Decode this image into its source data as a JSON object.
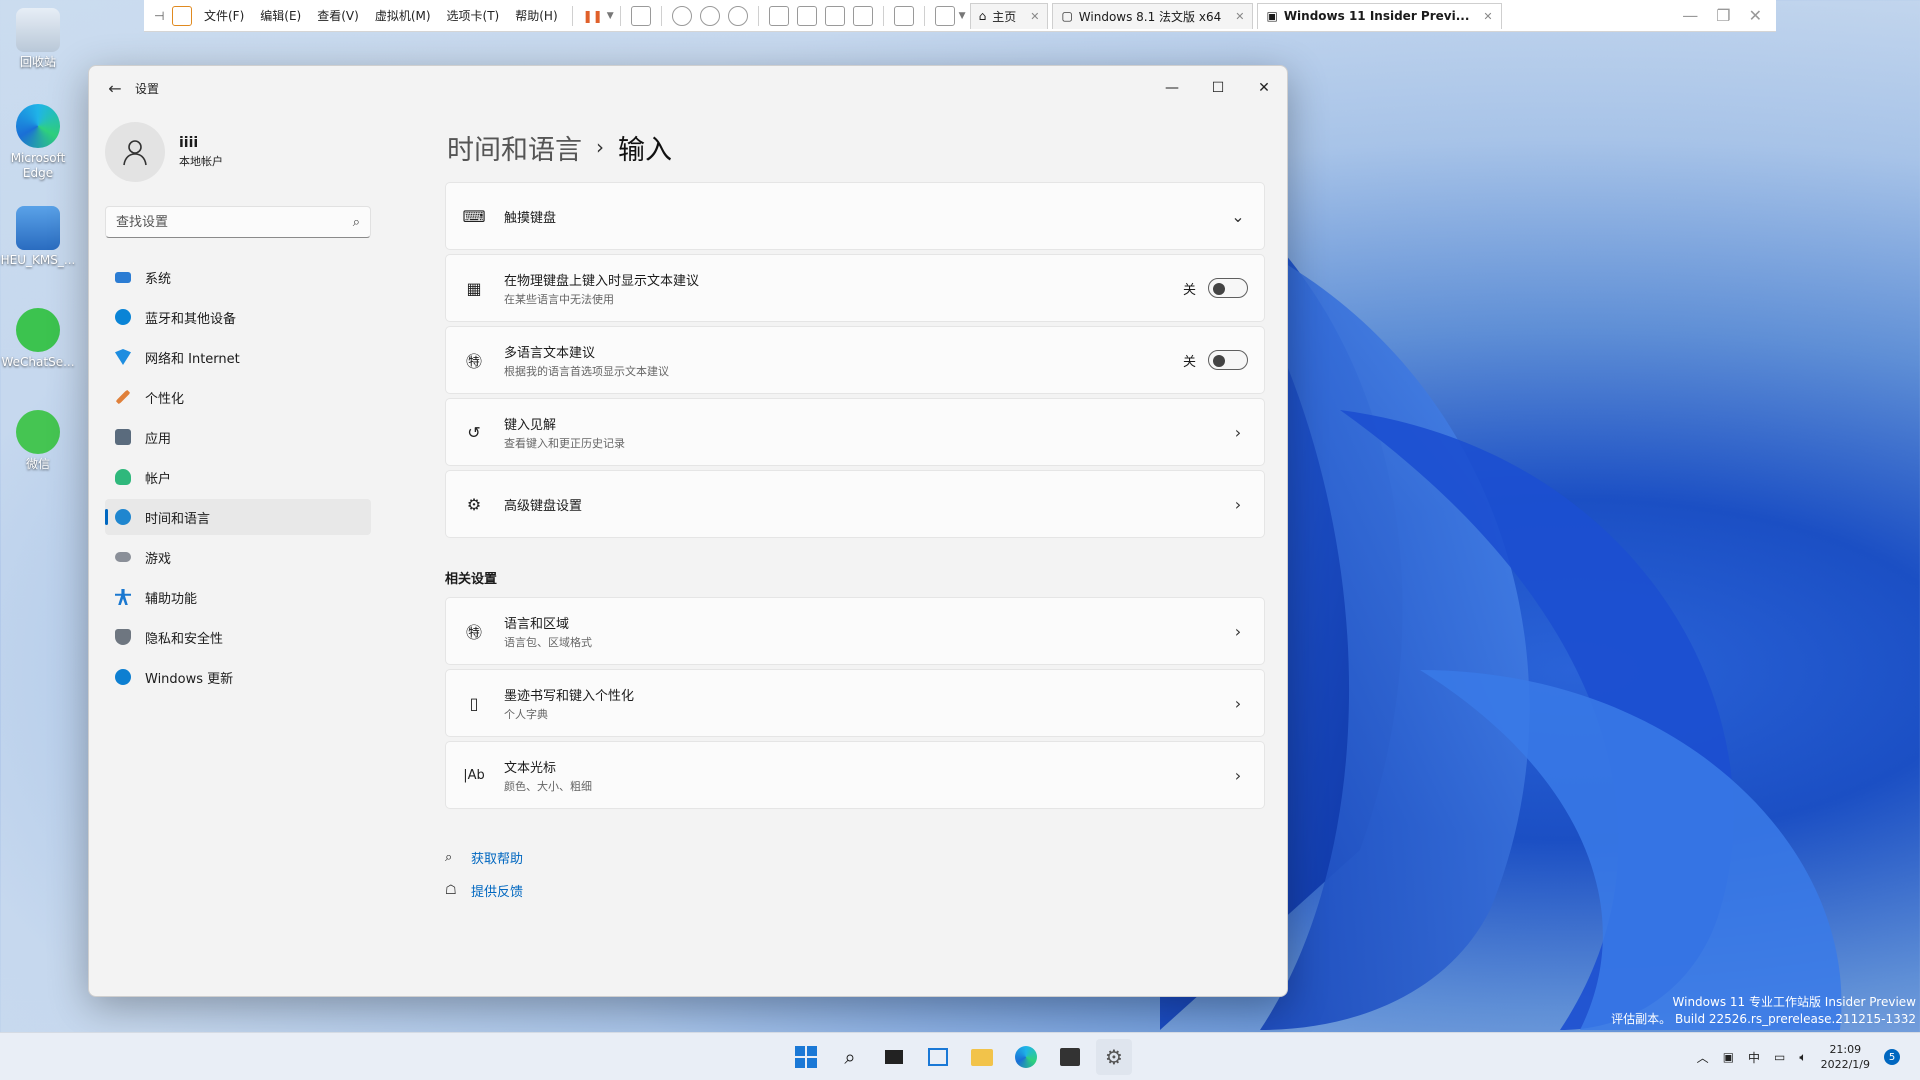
{
  "desktop": {
    "icons": [
      {
        "label": "回收站"
      },
      {
        "label": "Microsoft Edge"
      },
      {
        "label": "HEU_KMS_..."
      },
      {
        "label": "WeChatSe..."
      },
      {
        "label": "微信"
      }
    ],
    "watermark": {
      "line1": "Windows 11 专业工作站版 Insider Preview",
      "line2": "评估副本。 Build 22526.rs_prerelease.211215-1332"
    }
  },
  "vmware": {
    "menus": [
      "文件(F)",
      "编辑(E)",
      "查看(V)",
      "虚拟机(M)",
      "选项卡(T)",
      "帮助(H)"
    ],
    "tabs": [
      {
        "label": "主页"
      },
      {
        "label": "Windows 8.1 法文版 x64"
      },
      {
        "label": "Windows 11 Insider Previ..."
      }
    ]
  },
  "window": {
    "title": "设置",
    "controls": {
      "minimize": "—",
      "maximize": "☐",
      "close": "✕"
    }
  },
  "profile": {
    "name": "iiii",
    "type": "本地帐户"
  },
  "search": {
    "placeholder": "查找设置"
  },
  "nav": [
    {
      "label": "系统",
      "color": "#2b7cd3"
    },
    {
      "label": "蓝牙和其他设备",
      "color": "#0a84d6"
    },
    {
      "label": "网络和 Internet",
      "color": "#1d8de0"
    },
    {
      "label": "个性化",
      "color": "#e0803a"
    },
    {
      "label": "应用",
      "color": "#5a6b7d"
    },
    {
      "label": "帐户",
      "color": "#2fb87c"
    },
    {
      "label": "时间和语言",
      "color": "#1f86cf"
    },
    {
      "label": "游戏",
      "color": "#8a8f98"
    },
    {
      "label": "辅助功能",
      "color": "#1a78d0"
    },
    {
      "label": "隐私和安全性",
      "color": "#6e7680"
    },
    {
      "label": "Windows 更新",
      "color": "#0d7fd1"
    }
  ],
  "breadcrumb": {
    "parent": "时间和语言",
    "sep": "›",
    "current": "输入"
  },
  "cards": [
    {
      "title": "触摸键盘",
      "sub": "",
      "action": "⌄"
    },
    {
      "title": "在物理键盘上键入时显示文本建议",
      "sub": "在某些语言中无法使用",
      "toggle": "关"
    },
    {
      "title": "多语言文本建议",
      "sub": "根据我的语言首选项显示文本建议",
      "toggle": "关"
    },
    {
      "title": "键入见解",
      "sub": "查看键入和更正历史记录",
      "action": "›"
    },
    {
      "title": "高级键盘设置",
      "sub": "",
      "action": "›"
    }
  ],
  "related": {
    "heading": "相关设置",
    "cards": [
      {
        "title": "语言和区域",
        "sub": "语言包、区域格式",
        "action": "›"
      },
      {
        "title": "墨迹书写和键入个性化",
        "sub": "个人字典",
        "action": "›"
      },
      {
        "title": "文本光标",
        "sub": "颜色、大小、粗细",
        "action": "›",
        "icon_text": "|Ab"
      }
    ]
  },
  "help": {
    "get_help": "获取帮助",
    "feedback": "提供反馈"
  },
  "taskbar": {
    "tray_ime": "中",
    "time": "21:09",
    "date": "2022/1/9",
    "badge": "5"
  }
}
